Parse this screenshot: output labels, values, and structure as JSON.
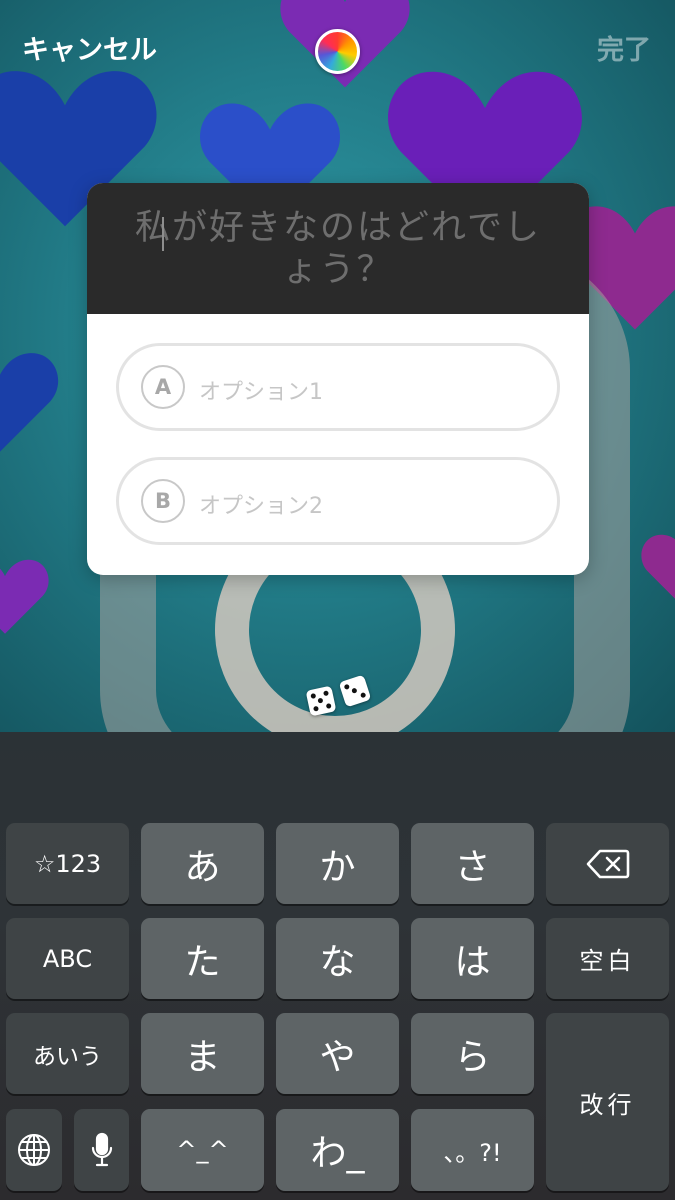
{
  "topbar": {
    "cancel_label": "キャンセル",
    "done_label": "完了"
  },
  "quiz": {
    "question": "私が好きなのはどれでしょう？",
    "options": [
      {
        "letter": "A",
        "placeholder": "オプション1"
      },
      {
        "letter": "B",
        "placeholder": "オプション2"
      }
    ]
  },
  "keyboard": {
    "rows": [
      [
        "☆123",
        "あ",
        "か",
        "さ",
        "backspace"
      ],
      [
        "ABC",
        "た",
        "な",
        "は",
        "空白"
      ],
      [
        "あいう",
        "ま",
        "や",
        "ら",
        "改行"
      ],
      [
        "globe",
        "mic",
        "^_^",
        "わ_",
        "、。?!"
      ]
    ]
  },
  "colors": {
    "card_header": "#2a2a2a",
    "key_dark": "#3f4446",
    "key_light": "#5e6466"
  }
}
